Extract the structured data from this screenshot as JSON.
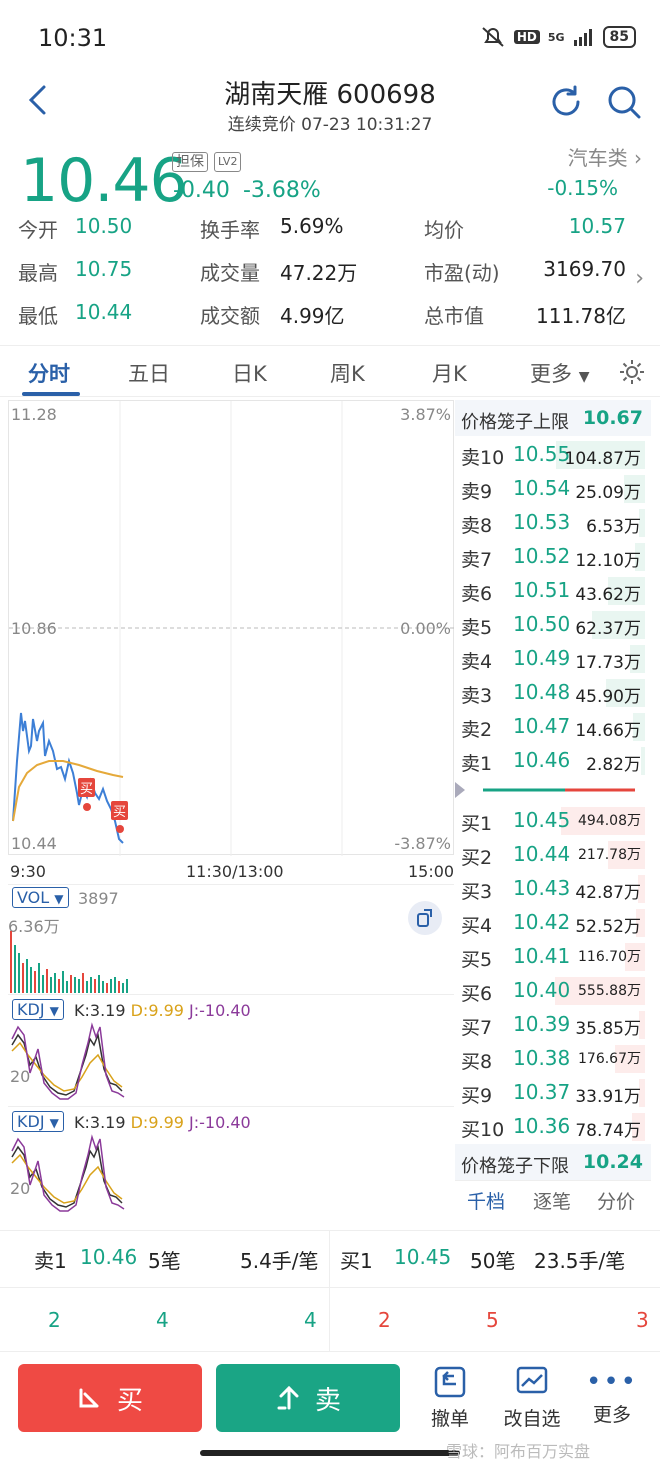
{
  "status": {
    "time": "10:31",
    "network": "5G",
    "hd": "HD",
    "battery": "85"
  },
  "header": {
    "title": "湖南天雁 600698",
    "subtitle": "连续竞价 07-23 10:31:27"
  },
  "quote": {
    "price": "10.46",
    "tag1": "担保",
    "tag2": "LV2",
    "change": "-0.40",
    "change_pct": "-3.68%",
    "sector": "汽车类",
    "sector_change": "-0.15%"
  },
  "stats": [
    {
      "label": "今开",
      "value": "10.50"
    },
    {
      "label": "换手率",
      "value": "5.69%"
    },
    {
      "label": "均价",
      "value": "10.57"
    },
    {
      "label": "最高",
      "value": "10.75"
    },
    {
      "label": "成交量",
      "value": "47.22万"
    },
    {
      "label": "市盈(动)",
      "value": "3169.70"
    },
    {
      "label": "最低",
      "value": "10.44"
    },
    {
      "label": "成交额",
      "value": "4.99亿"
    },
    {
      "label": "总市值",
      "value": "111.78亿"
    }
  ],
  "tabs": [
    "分时",
    "五日",
    "日K",
    "周K",
    "月K",
    "更多"
  ],
  "chart": {
    "y_top": "11.28",
    "y_mid": "10.86",
    "y_bot": "10.44",
    "pct_top": "3.87%",
    "pct_mid": "0.00%",
    "pct_bot": "-3.87%",
    "x_start": "9:30",
    "x_mid": "11:30/13:00",
    "x_end": "15:00",
    "buy_marker": "买",
    "vol_label": "VOL",
    "vol_value": "3897",
    "vol_max": "6.36万",
    "kdj_label": "KDJ",
    "kdj_k": "K:3.19",
    "kdj_d": "D:9.99",
    "kdj_j": "J:-10.40",
    "kdj_tick": "20"
  },
  "orderbook": {
    "upper_limit_label": "价格笼子上限",
    "upper_limit": "10.67",
    "lower_limit_label": "价格笼子下限",
    "lower_limit": "10.24",
    "asks": [
      {
        "label": "卖10",
        "price": "10.55",
        "vol": "104.87万"
      },
      {
        "label": "卖9",
        "price": "10.54",
        "vol": "25.09万"
      },
      {
        "label": "卖8",
        "price": "10.53",
        "vol": "6.53万"
      },
      {
        "label": "卖7",
        "price": "10.52",
        "vol": "12.10万"
      },
      {
        "label": "卖6",
        "price": "10.51",
        "vol": "43.62万"
      },
      {
        "label": "卖5",
        "price": "10.50",
        "vol": "62.37万"
      },
      {
        "label": "卖4",
        "price": "10.49",
        "vol": "17.73万"
      },
      {
        "label": "卖3",
        "price": "10.48",
        "vol": "45.90万"
      },
      {
        "label": "卖2",
        "price": "10.47",
        "vol": "14.66万"
      },
      {
        "label": "卖1",
        "price": "10.46",
        "vol": "2.82万"
      }
    ],
    "bids": [
      {
        "label": "买1",
        "price": "10.45",
        "vol": "494.08万"
      },
      {
        "label": "买2",
        "price": "10.44",
        "vol": "217.78万"
      },
      {
        "label": "买3",
        "price": "10.43",
        "vol": "42.87万"
      },
      {
        "label": "买4",
        "price": "10.42",
        "vol": "52.52万"
      },
      {
        "label": "买5",
        "price": "10.41",
        "vol": "116.70万"
      },
      {
        "label": "买6",
        "price": "10.40",
        "vol": "555.88万"
      },
      {
        "label": "买7",
        "price": "10.39",
        "vol": "35.85万"
      },
      {
        "label": "买8",
        "price": "10.38",
        "vol": "176.67万"
      },
      {
        "label": "买9",
        "price": "10.37",
        "vol": "33.91万"
      },
      {
        "label": "买10",
        "price": "10.36",
        "vol": "78.74万"
      }
    ],
    "tabs": [
      "千档",
      "逐笔",
      "分价"
    ]
  },
  "summary": {
    "sell": {
      "label": "卖1",
      "price": "10.46",
      "count": "5笔",
      "size": "5.4手/笔"
    },
    "buy": {
      "label": "买1",
      "price": "10.45",
      "count": "50笔",
      "size": "23.5手/笔"
    },
    "sell_nums": [
      "2",
      "4",
      "4"
    ],
    "buy_nums": [
      "2",
      "5",
      "3"
    ]
  },
  "actions": {
    "buy": "买",
    "sell": "卖",
    "cancel": "撤单",
    "watchlist": "改自选",
    "more": "更多"
  },
  "watermark": "雪球：阿布百万实盘"
}
